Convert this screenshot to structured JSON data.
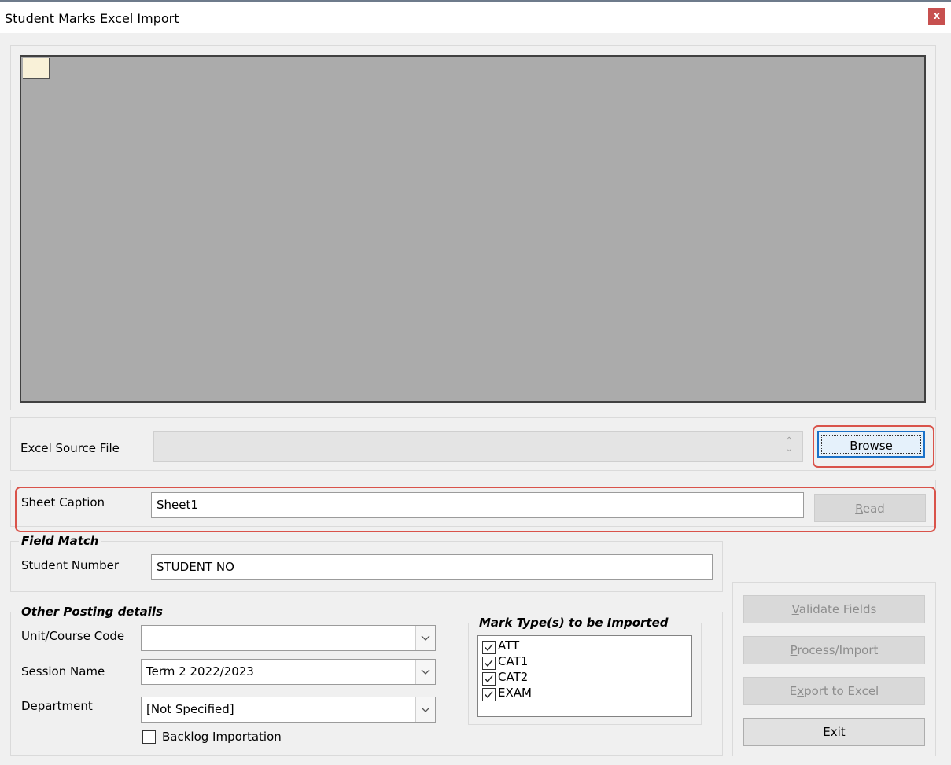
{
  "window": {
    "title": "Student Marks Excel Import",
    "close_label": "x"
  },
  "source": {
    "label": "Excel Source File",
    "value": "",
    "browse_label": "Browse",
    "browse_mnemonic": "B",
    "browse_rest": "rowse"
  },
  "sheet": {
    "label": "Sheet Caption",
    "value": "Sheet1",
    "read_mnemonic": "R",
    "read_rest": "ead"
  },
  "field_match": {
    "legend": "Field Match",
    "student_number_label": "Student Number",
    "student_number_value": "STUDENT NO"
  },
  "posting": {
    "legend": "Other Posting details",
    "unit_label": "Unit/Course Code",
    "unit_value": "",
    "session_label": "Session Name",
    "session_value": "Term 2 2022/2023",
    "department_label": "Department",
    "department_value": "[Not Specified]",
    "backlog_label": "Backlog Importation",
    "backlog_checked": false
  },
  "mark_types": {
    "legend": "Mark Type(s) to be Imported",
    "items": [
      {
        "label": "ATT",
        "checked": true
      },
      {
        "label": "CAT1",
        "checked": true
      },
      {
        "label": "CAT2",
        "checked": true
      },
      {
        "label": "EXAM",
        "checked": true
      }
    ]
  },
  "actions": {
    "validate_mnemonic": "V",
    "validate_rest": "alidate Fields",
    "process_mnemonic": "P",
    "process_rest": "rocess/Import",
    "export_pre": "E",
    "export_mnemonic": "x",
    "export_rest": "port to Excel",
    "exit_mnemonic": "E",
    "exit_rest": "xit"
  },
  "colors": {
    "highlight": "#d9534a",
    "grid_bg": "#ababab",
    "close_bg": "#c7504f"
  }
}
